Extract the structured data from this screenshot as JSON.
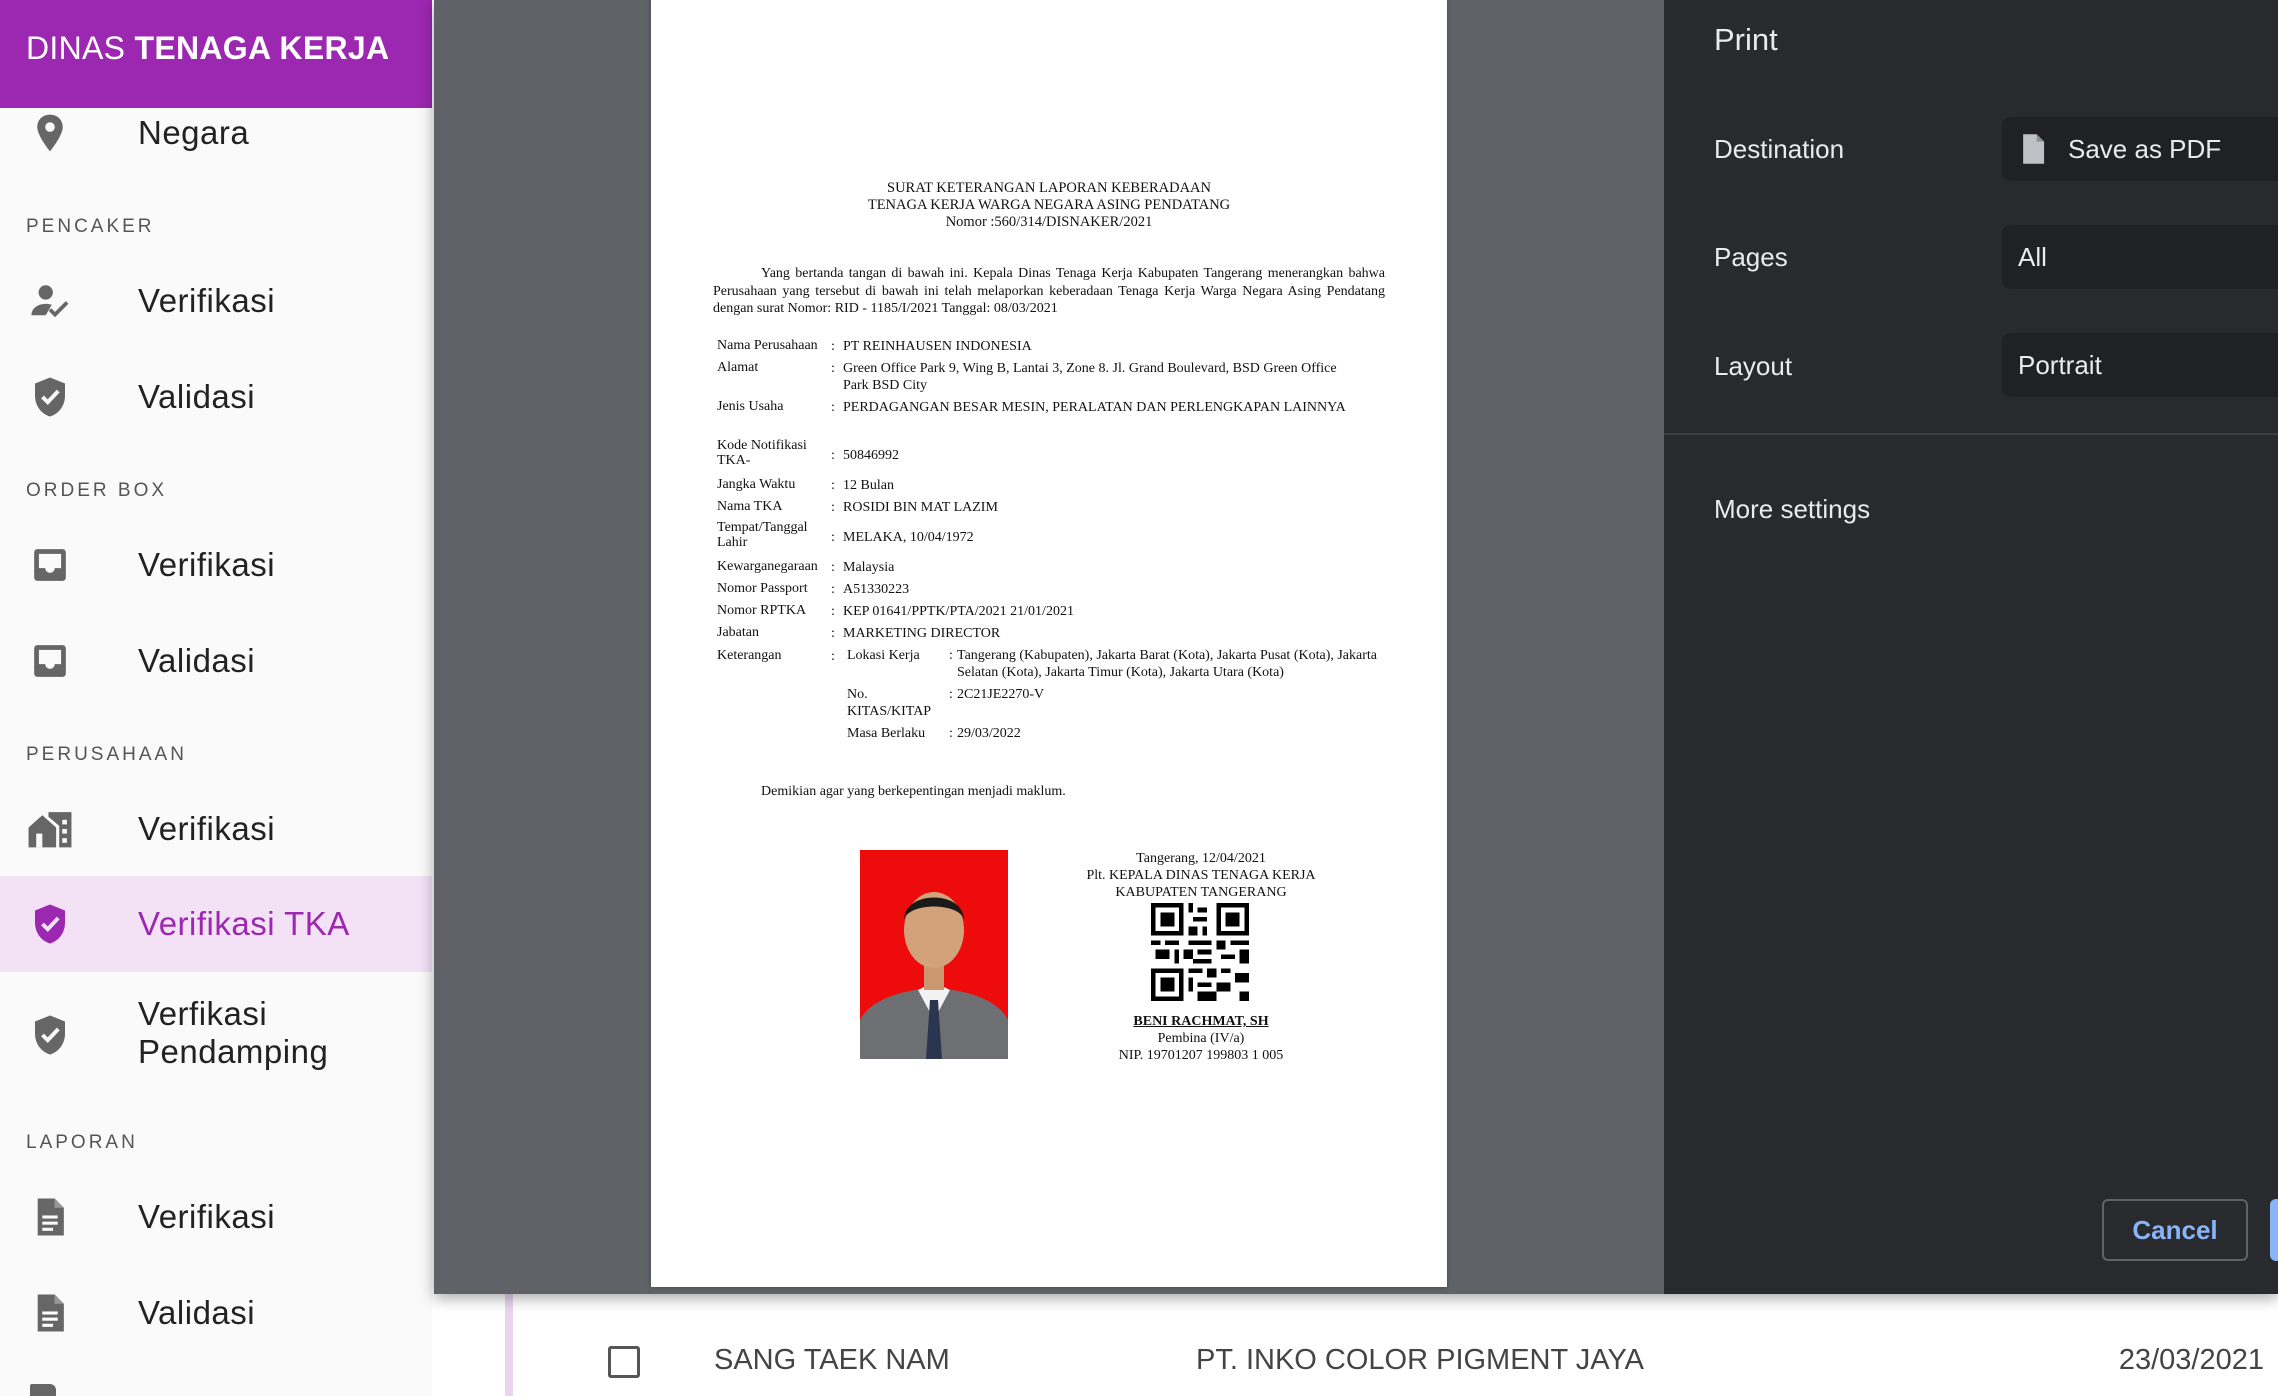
{
  "sidebar": {
    "brand_light": "DINAS ",
    "brand_bold": "TENAGA KERJA",
    "top_item": "Negara",
    "sections": {
      "pencaker": "PENCAKER",
      "order_box": "ORDER BOX",
      "perusahaan": "PERUSAHAAN",
      "laporan": "LAPORAN"
    },
    "items": {
      "pencaker_verifikasi": "Verifikasi",
      "pencaker_validasi": "Validasi",
      "orderbox_verifikasi": "Verifikasi",
      "orderbox_validasi": "Validasi",
      "perusahaan_verifikasi": "Verifikasi",
      "verifikasi_tka": "Verifikasi TKA",
      "verfikasi_pendamping_1": "Verfikasi",
      "verfikasi_pendamping_2": "Pendamping",
      "laporan_verifikasi": "Verifikasi",
      "laporan_validasi": "Validasi"
    },
    "accent_color": "#9c27b0"
  },
  "table_row": {
    "name": "SANG TAEK NAM",
    "company": "PT. INKO COLOR PIGMENT JAYA",
    "date": "23/03/2021"
  },
  "document": {
    "title_1": "SURAT KETERANGAN LAPORAN KEBERADAAN",
    "title_2": "TENAGA KERJA WARGA NEGARA ASING PENDATANG",
    "title_3": "Nomor :560/314/DISNAKER/2021",
    "intro": "Yang bertanda tangan di bawah ini. Kepala Dinas Tenaga Kerja Kabupaten Tangerang menerangkan bahwa Perusahaan yang tersebut di bawah ini telah melaporkan keberadaan Tenaga Kerja Warga Negara Asing Pendatang dengan surat Nomor: RID - 1185/I/2021 Tanggal: 08/03/2021",
    "fields": [
      {
        "label": "Nama Perusahaan",
        "value": "PT REINHAUSEN INDONESIA"
      },
      {
        "label": "Alamat",
        "value": "Green Office Park 9, Wing B, Lantai 3, Zone 8. Jl. Grand Boulevard, BSD Green Office Park BSD City"
      },
      {
        "label": "Jenis Usaha",
        "value": "PERDAGANGAN BESAR MESIN, PERALATAN DAN PERLENGKAPAN LAINNYA"
      },
      {
        "label": "Kode Notifikasi TKA-",
        "value": "50846992"
      },
      {
        "label": "Jangka Waktu",
        "value": "12 Bulan"
      },
      {
        "label": "Nama TKA",
        "value": "ROSIDI BIN MAT LAZIM"
      },
      {
        "label": "Tempat/Tanggal Lahir",
        "value": "MELAKA, 10/04/1972"
      },
      {
        "label": "Kewarganegaraan",
        "value": "Malaysia"
      },
      {
        "label": "Nomor Passport",
        "value": "A51330223"
      },
      {
        "label": "Nomor RPTKA",
        "value": "KEP 01641/PPTK/PTA/2021 21/01/2021"
      },
      {
        "label": "Jabatan",
        "value": "MARKETING DIRECTOR"
      },
      {
        "label": "Keterangan",
        "value": ""
      }
    ],
    "keterangan": [
      {
        "label": "Lokasi Kerja",
        "value": "Tangerang (Kabupaten), Jakarta Barat (Kota), Jakarta Pusat (Kota), Jakarta Selatan (Kota), Jakarta Timur (Kota), Jakarta Utara (Kota)"
      },
      {
        "label": "No. KITAS/KITAP",
        "value": "2C21JE2270-V"
      },
      {
        "label": "Masa Berlaku",
        "value": "29/03/2022"
      }
    ],
    "closing": "Demikian agar yang berkepentingan menjadi maklum.",
    "signature": {
      "place_date": "Tangerang, 12/04/2021",
      "position_1": "Plt. KEPALA DINAS TENAGA KERJA",
      "position_2": "KABUPATEN TANGERANG",
      "name": "BENI RACHMAT, SH",
      "rank": "Pembina (IV/a)",
      "nip": "NIP. 19701207 199803 1 005"
    }
  },
  "print": {
    "title": "Print",
    "destination_label": "Destination",
    "destination_value": "Save as PDF",
    "pages_label": "Pages",
    "pages_value": "All",
    "layout_label": "Layout",
    "layout_value": "Portrait",
    "more_settings": "More settings",
    "cancel": "Cancel"
  }
}
